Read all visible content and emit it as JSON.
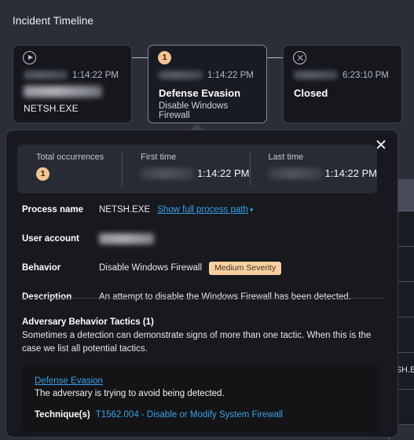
{
  "page": {
    "background_color": "#2b2e37",
    "panel_color": "#17191f",
    "accent_link": "#3aa0e8",
    "accent_badge": "#f5c391"
  },
  "timeline": {
    "title": "Incident Timeline",
    "cards": [
      {
        "icon": "play-circle-icon",
        "date_redacted": true,
        "time": "1:14:22 PM",
        "host_redacted": true,
        "process": "NETSH.EXE",
        "selected": false
      },
      {
        "icon": "count-badge",
        "count": "1",
        "date_redacted": true,
        "time": "1:14:22 PM",
        "title": "Defense Evasion",
        "subtitle": "Disable Windows Firewall",
        "selected": true
      },
      {
        "icon": "close-circle-icon",
        "date_redacted": true,
        "time": "6:23:10 PM",
        "title": "Closed",
        "selected": false
      }
    ]
  },
  "panel": {
    "close_label": "close-icon",
    "summary": [
      {
        "label": "Total occurrences",
        "value": "1",
        "type": "badge"
      },
      {
        "label": "First time",
        "value": "1:14:22 PM",
        "type": "redacted-datetime"
      },
      {
        "label": "Last time",
        "value": "1:14:22 PM",
        "type": "redacted-datetime"
      }
    ],
    "fields": {
      "process_name_label": "Process name",
      "process_name_value": "NETSH.EXE",
      "process_path_link": "Show full process path",
      "user_account_label": "User account",
      "user_account_value_redacted": true,
      "behavior_label": "Behavior",
      "behavior_value": "Disable Windows Firewall",
      "behavior_severity": "Medium Severity",
      "description_label": "Description",
      "description_value": "An attempt to disable the Windows Firewall has been detected."
    },
    "tactics": {
      "heading": "Adversary Behavior Tactics (1)",
      "description": "Sometimes a detection can demonstrate signs of more than one tactic. When this is the case we list all potential tactics.",
      "items": [
        {
          "name": "Defense Evasion",
          "summary": "The adversary is trying to avoid being detected.",
          "technique_label": "Technique(s)",
          "technique_value": "T1562.004 - Disable or Modify System Firewall"
        }
      ]
    }
  },
  "background_table": {
    "rows": [
      "",
      "",
      "",
      "",
      "TSH.E",
      ""
    ]
  }
}
